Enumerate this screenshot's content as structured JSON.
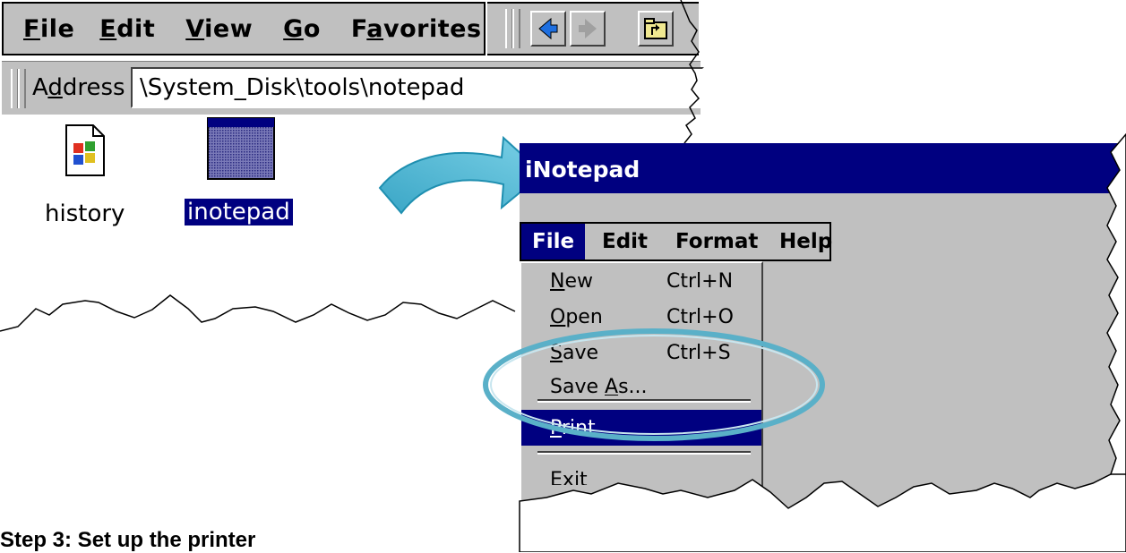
{
  "explorer": {
    "menu": [
      {
        "pre": "",
        "u": "F",
        "post": "ile"
      },
      {
        "pre": "",
        "u": "E",
        "post": "dit"
      },
      {
        "pre": "",
        "u": "V",
        "post": "iew"
      },
      {
        "pre": "",
        "u": "G",
        "post": "o"
      },
      {
        "pre": "F",
        "u": "a",
        "post": "vorites"
      }
    ],
    "address": {
      "pre": "A",
      "u": "d",
      "post": "dress",
      "value": "\\System_Disk\\tools\\notepad"
    },
    "files": [
      {
        "label": "history",
        "icon": "windows-document-icon",
        "selected": false
      },
      {
        "label": "inotepad",
        "icon": "application-window-icon",
        "selected": true
      }
    ]
  },
  "notepad": {
    "title": "iNotepad",
    "menu": [
      "File",
      "Edit",
      "Format",
      "Help"
    ],
    "active_menu": "File",
    "file_menu": [
      {
        "u": "N",
        "post": "ew",
        "shortcut": "Ctrl+N"
      },
      {
        "u": "O",
        "post": "pen",
        "shortcut": "Ctrl+O"
      },
      {
        "u": "S",
        "post": "ave",
        "shortcut": "Ctrl+S"
      },
      {
        "pre": "Save ",
        "u": "A",
        "post": "s...",
        "shortcut": ""
      },
      {
        "u": "P",
        "post": "rint",
        "shortcut": "",
        "highlighted": true
      },
      {
        "pre": "E",
        "u": "x",
        "post": "it",
        "shortcut": ""
      }
    ]
  },
  "caption": "Step 3: Set up the printer",
  "colors": {
    "titlebar": "#000080",
    "window_face": "#c0c0c0",
    "arrow": "#4cb6d4",
    "highlight_ellipse": "#5ab0c8"
  }
}
